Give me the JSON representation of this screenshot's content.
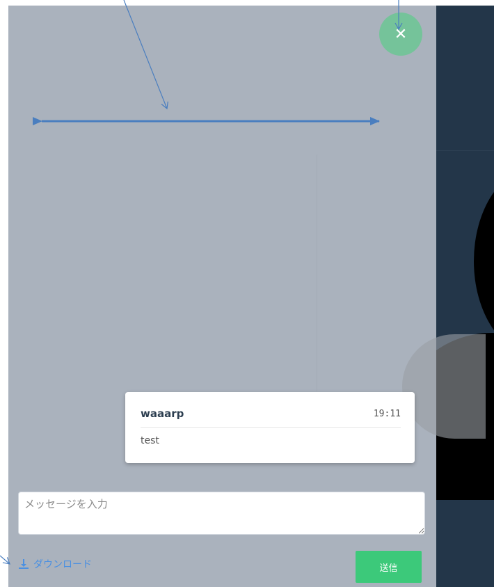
{
  "close_button": {
    "icon": "close-icon",
    "symbol": "✕"
  },
  "message": {
    "author": "waaarp",
    "time": "19:11",
    "text": "test"
  },
  "input": {
    "placeholder": "メッセージを入力",
    "value": ""
  },
  "download": {
    "icon": "download-icon",
    "label": "ダウンロード"
  },
  "send": {
    "label": "送信"
  },
  "colors": {
    "panel_bg": "#aab2bd",
    "right_panel_bg": "#233649",
    "close_button": "#75c39a",
    "send_button": "#3cc97a",
    "link": "#4a90e2",
    "annotation_arrow": "#4a7ebf"
  }
}
